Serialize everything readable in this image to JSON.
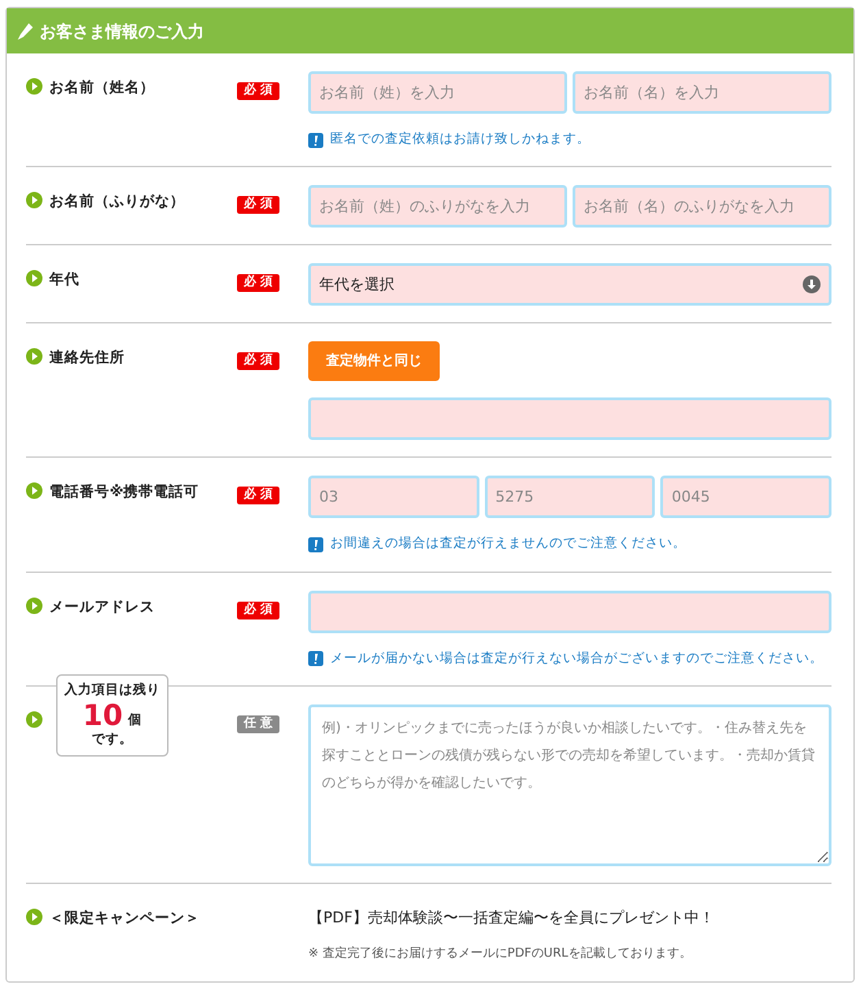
{
  "header": {
    "title": "お客さま情報のご入力"
  },
  "rows": [
    {
      "label": "お名前（姓名）",
      "badge": {
        "text": "必 須",
        "kind": "required"
      },
      "items": [
        {
          "kind": "inputs",
          "fields": [
            {
              "placeholder": "お名前（姓）を入力"
            },
            {
              "placeholder": "お名前（名）を入力"
            }
          ]
        },
        {
          "kind": "note",
          "text": "匿名での査定依頼はお請け致しかねます。"
        }
      ]
    },
    {
      "label": "お名前（ふりがな）",
      "badge": {
        "text": "必 須",
        "kind": "required"
      },
      "items": [
        {
          "kind": "inputs",
          "fields": [
            {
              "placeholder": "お名前（姓）のふりがなを入力"
            },
            {
              "placeholder": "お名前（名）のふりがなを入力"
            }
          ]
        }
      ]
    },
    {
      "label": "年代",
      "badge": {
        "text": "必 須",
        "kind": "required"
      },
      "items": [
        {
          "kind": "select",
          "value": "年代を選択"
        }
      ]
    },
    {
      "label": "連絡先住所",
      "badge": {
        "text": "必 須",
        "kind": "required"
      },
      "items": [
        {
          "kind": "button",
          "text": "査定物件と同じ"
        },
        {
          "kind": "field"
        }
      ]
    },
    {
      "label": "電話番号※携帯電話可",
      "badge": {
        "text": "必 須",
        "kind": "required"
      },
      "items": [
        {
          "kind": "inputs",
          "fields": [
            {
              "placeholder": "03"
            },
            {
              "placeholder": "5275"
            },
            {
              "placeholder": "0045"
            }
          ]
        },
        {
          "kind": "note",
          "text": "お間違えの場合は査定が行えませんのでご注意ください。"
        }
      ]
    },
    {
      "label": "メールアドレス",
      "badge": {
        "text": "必 須",
        "kind": "required"
      },
      "items": [
        {
          "kind": "field"
        },
        {
          "kind": "note",
          "text": "メールが届かない場合は査定が行えない場合がございますのでご注意ください。"
        }
      ]
    },
    {
      "badge": {
        "text": "任 意",
        "kind": "optional"
      },
      "items": [
        {
          "kind": "textarea",
          "placeholder": "例)・オリンピックまでに売ったほうが良いか相談したいです。・住み替え先を探すこととローンの残債が残らない形での売却を希望しています。・売却か賃貸のどちらが得かを確認したいです。"
        }
      ]
    },
    {
      "label": "＜限定キャンペーン＞",
      "items": [
        {
          "kind": "text",
          "text": "【PDF】売却体験談〜一括査定編〜を全員にプレゼント中！"
        },
        {
          "kind": "small",
          "text": "※ 査定完了後にお届けするメールにPDFのURLを記載しております。"
        }
      ]
    }
  ],
  "tooltip": {
    "line1": "入力項目は残り",
    "count": "10",
    "unit": "個",
    "line2": "です。"
  }
}
